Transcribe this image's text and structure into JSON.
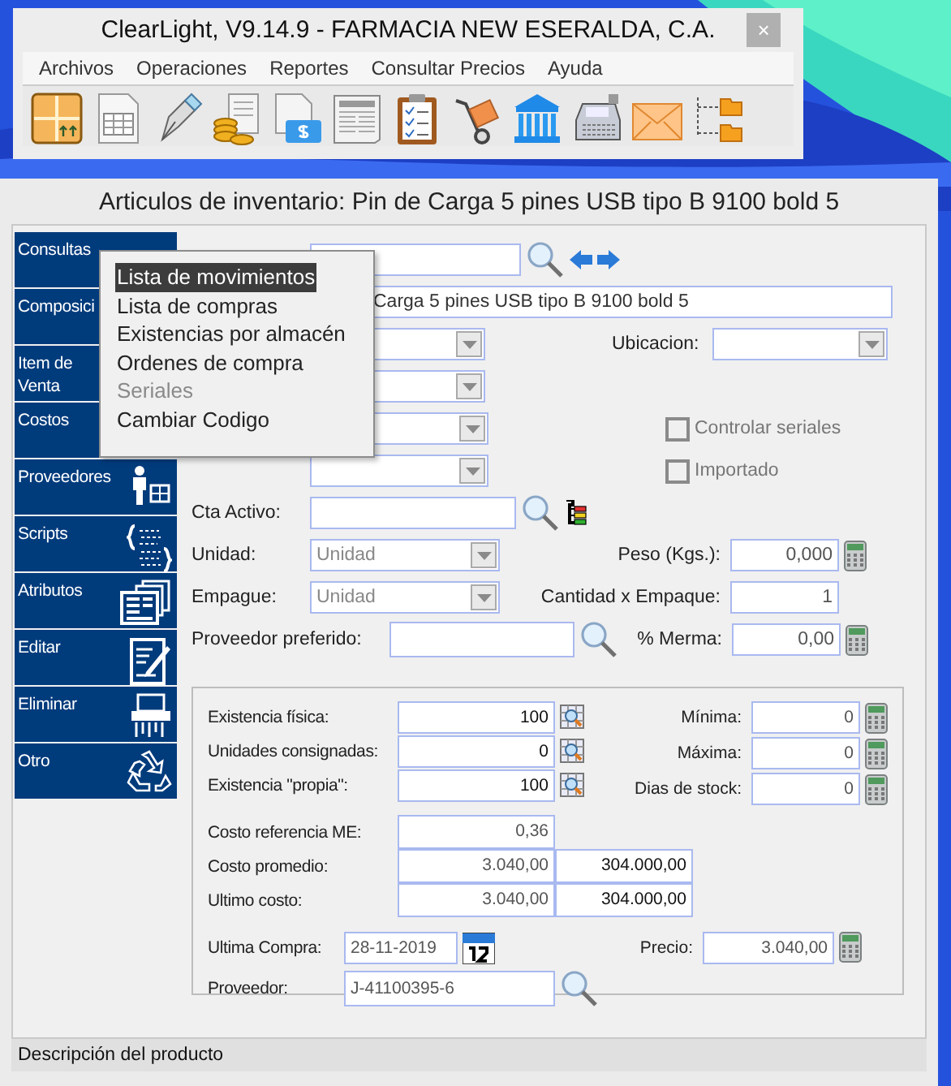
{
  "app_window": {
    "title": "ClearLight, V9.14.9 - FARMACIA NEW ESERALDA, C.A.",
    "close": "×",
    "menu": [
      "Archivos",
      "Operaciones",
      "Reportes",
      "Consultar Precios",
      "Ayuda"
    ]
  },
  "form_window": {
    "title": "Articulos de inventario: Pin de Carga 5 pines USB tipo B 9100 bold 5",
    "status_bar": "Descripción del producto"
  },
  "sidebar": [
    {
      "label": "Consultas"
    },
    {
      "label": "Composici"
    },
    {
      "label": "Item de Venta"
    },
    {
      "label": "Costos"
    },
    {
      "label": "Proveedores"
    },
    {
      "label": "Scripts"
    },
    {
      "label": "Atributos"
    },
    {
      "label": "Editar"
    },
    {
      "label": "Eliminar"
    },
    {
      "label": "Otro"
    }
  ],
  "context_menu": [
    {
      "label": "Lista de movimientos",
      "selected": true,
      "disabled": false
    },
    {
      "label": "Lista de compras",
      "selected": false,
      "disabled": false
    },
    {
      "label": "Existencias por almacén",
      "selected": false,
      "disabled": false
    },
    {
      "label": "Ordenes de compra",
      "selected": false,
      "disabled": false
    },
    {
      "label": "Seriales",
      "selected": false,
      "disabled": true
    },
    {
      "label": "Cambiar Codigo",
      "selected": false,
      "disabled": false
    }
  ],
  "form": {
    "description": {
      "value": "Carga 5 pines USB tipo B 9100 bold 5"
    },
    "ubicacion": {
      "label": "Ubicacion:"
    },
    "checkboxes": [
      {
        "label": "Controlar seriales",
        "checked": false,
        "disabled": true
      },
      {
        "label": "Importado",
        "checked": false,
        "disabled": true
      }
    ],
    "cta_activo": {
      "label": "Cta Activo:"
    },
    "unidad": {
      "label": "Unidad:",
      "value": "Unidad"
    },
    "peso": {
      "label": "Peso (Kgs.):",
      "value": "0,000"
    },
    "empaque": {
      "label": "Empague:",
      "value": "Unidad"
    },
    "cantidad_x_empaque": {
      "label": "Cantidad x Empaque:",
      "value": "1"
    },
    "proveedor_preferido": {
      "label": "Proveedor preferido:"
    },
    "merma": {
      "label": "% Merma:",
      "value": "0,00"
    },
    "stock": [
      {
        "label": "Existencia física:",
        "value": "100"
      },
      {
        "label": "Unidades consignadas:",
        "value": "0"
      },
      {
        "label": "Existencia \"propia\":",
        "value": "100"
      }
    ],
    "limits": [
      {
        "label": "Mínima:",
        "value": "0"
      },
      {
        "label": "Máxima:",
        "value": "0"
      },
      {
        "label": "Dias de stock:",
        "value": "0"
      }
    ],
    "costo_referencia_me": {
      "label": "Costo referencia ME:",
      "value": "0,36"
    },
    "costs": [
      {
        "label": "Costo promedio:",
        "unit_value": "3.040,00",
        "total_value": "304.000,00"
      },
      {
        "label": "Ultimo costo:",
        "unit_value": "3.040,00",
        "total_value": "304.000,00"
      }
    ],
    "ultima_compra": {
      "label": "Ultima Compra:",
      "value": "28-11-2019"
    },
    "precio": {
      "label": "Precio:",
      "value": "3.040,00"
    },
    "proveedor": {
      "label": "Proveedor:",
      "value": "J-41100395-6"
    }
  }
}
